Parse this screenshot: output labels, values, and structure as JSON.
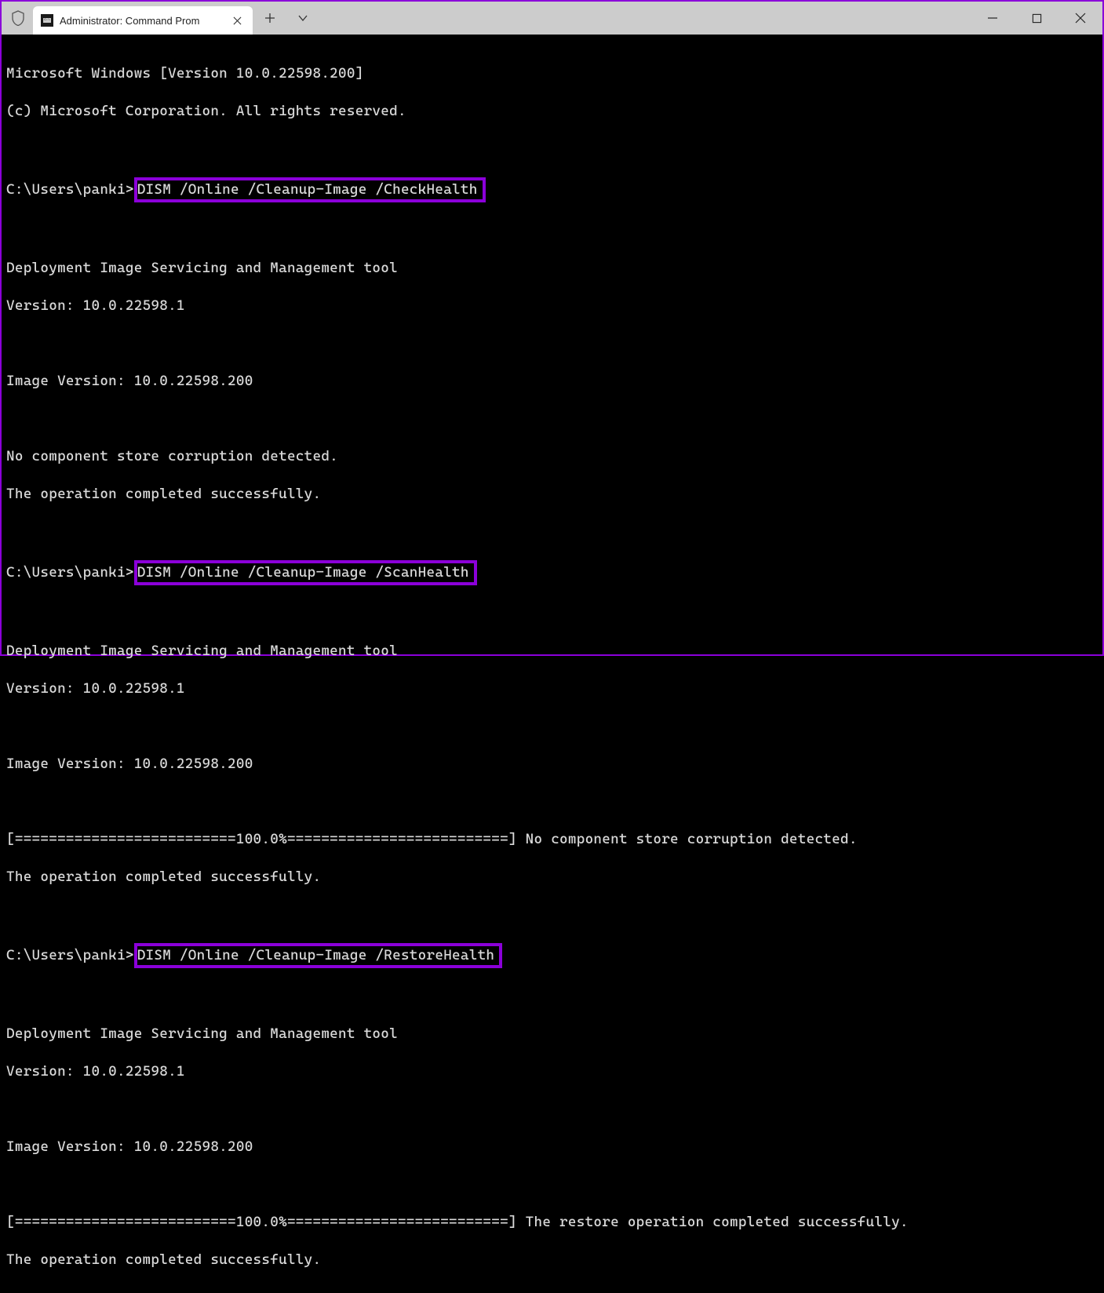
{
  "window": {
    "tab_title": "Administrator: Command Prom"
  },
  "terminal": {
    "header1": "Microsoft Windows [Version 10.0.22598.200]",
    "header2": "(c) Microsoft Corporation. All rights reserved.",
    "prompt": "C:\\Users\\panki>",
    "cmd1": "DISM /Online /Cleanup-Image /CheckHealth",
    "cmd2": "DISM /Online /Cleanup-Image /ScanHealth",
    "cmd3": "DISM /Online /Cleanup-Image /RestoreHealth",
    "dism_tool": "Deployment Image Servicing and Management tool",
    "dism_version": "Version: 10.0.22598.1",
    "image_version": "Image Version: 10.0.22598.200",
    "no_corruption": "No component store corruption detected.",
    "op_complete": "The operation completed successfully.",
    "progress_line1": "[==========================100.0%==========================] No component store corruption detected.",
    "progress_line2": "[==========================100.0%==========================] The restore operation completed successfully."
  }
}
